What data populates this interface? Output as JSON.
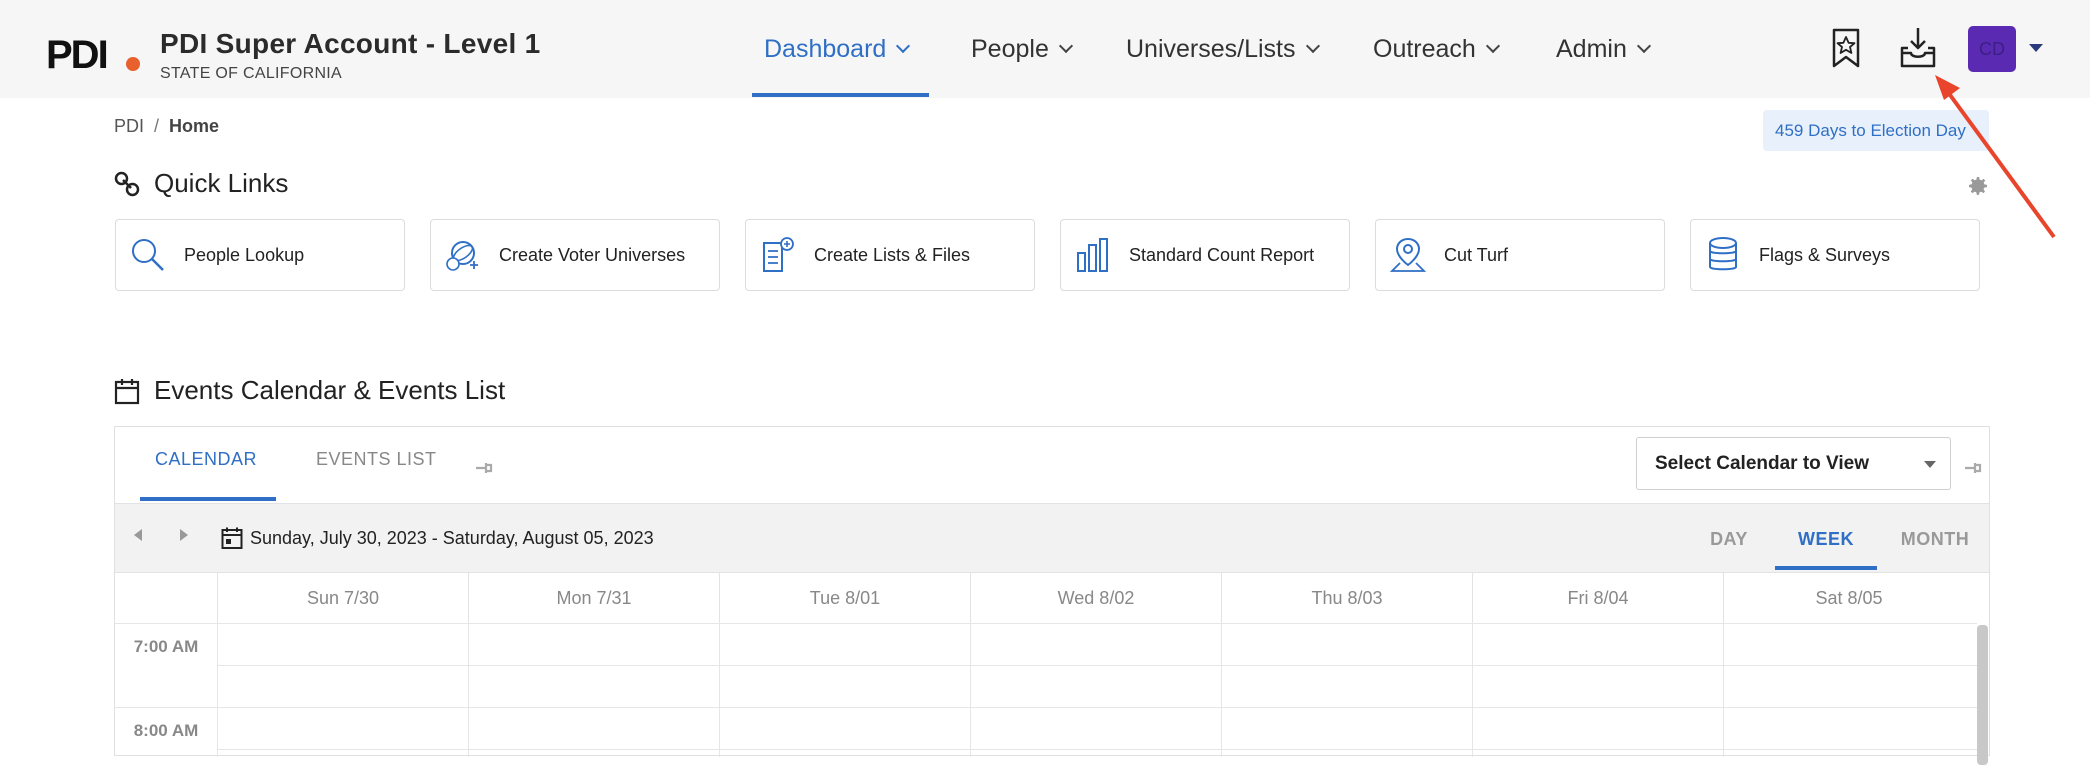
{
  "header": {
    "logo_text": "PDI",
    "title": "PDI Super Account - Level 1",
    "subtitle": "STATE OF CALIFORNIA",
    "nav": [
      {
        "label": "Dashboard",
        "active": true
      },
      {
        "label": "People"
      },
      {
        "label": "Universes/Lists"
      },
      {
        "label": "Outreach"
      },
      {
        "label": "Admin"
      }
    ],
    "icons": [
      "bookmark-star-icon",
      "download-inbox-icon"
    ],
    "avatar_initials": "CD"
  },
  "breadcrumb": {
    "root": "PDI",
    "separator": "/",
    "current": "Home"
  },
  "election_badge": "459 Days to Election Day",
  "quick_links": {
    "title": "Quick Links",
    "items": [
      {
        "label": "People Lookup",
        "icon": "magnifier-icon"
      },
      {
        "label": "Create Voter Universes",
        "icon": "globe-plus-icon"
      },
      {
        "label": "Create Lists & Files",
        "icon": "document-plus-icon"
      },
      {
        "label": "Standard Count Report",
        "icon": "bar-chart-icon"
      },
      {
        "label": "Cut Turf",
        "icon": "map-pin-icon"
      },
      {
        "label": "Flags & Surveys",
        "icon": "database-icon"
      }
    ]
  },
  "events": {
    "title": "Events Calendar & Events List",
    "tabs": [
      {
        "label": "CALENDAR",
        "active": true
      },
      {
        "label": "EVENTS LIST"
      }
    ],
    "select_calendar": "Select Calendar to View",
    "date_range": "Sunday, July 30, 2023 - Saturday, August 05, 2023",
    "views": [
      {
        "label": "DAY"
      },
      {
        "label": "WEEK",
        "active": true
      },
      {
        "label": "MONTH"
      }
    ],
    "days": [
      "Sun 7/30",
      "Mon 7/31",
      "Tue 8/01",
      "Wed 8/02",
      "Thu 8/03",
      "Fri 8/04",
      "Sat 8/05"
    ],
    "times": [
      "7:00 AM",
      "8:00 AM"
    ]
  },
  "colors": {
    "accent": "#2f6fc5",
    "avatar": "#5a2ab3",
    "logo_orange": "#e8602c",
    "annotation_arrow": "#e8452c"
  }
}
